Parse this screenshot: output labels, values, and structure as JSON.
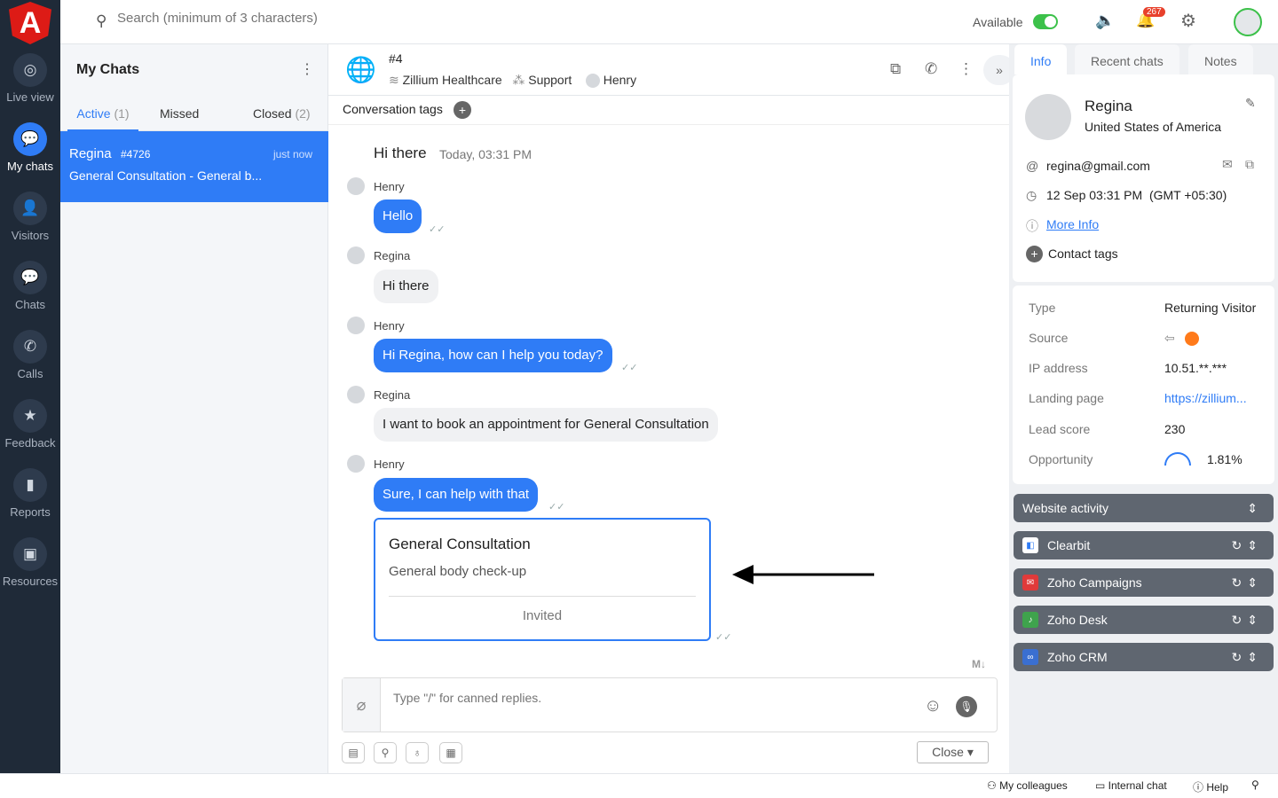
{
  "topbar": {
    "search_placeholder": "Search (minimum of 3 characters)",
    "status": "Available",
    "notifications": "267"
  },
  "sidebar": {
    "logo": "A",
    "items": [
      {
        "label": "Live view",
        "icon": "◎"
      },
      {
        "label": "My chats",
        "icon": "💬"
      },
      {
        "label": "Visitors",
        "icon": "👤"
      },
      {
        "label": "Chats",
        "icon": "💬"
      },
      {
        "label": "Calls",
        "icon": "✆"
      },
      {
        "label": "Feedback",
        "icon": "★"
      },
      {
        "label": "Reports",
        "icon": "▮"
      },
      {
        "label": "Resources",
        "icon": "▣"
      }
    ]
  },
  "list": {
    "title": "My Chats",
    "tabs": [
      {
        "label": "Active",
        "count": "(1)"
      },
      {
        "label": "Missed",
        "count": ""
      },
      {
        "label": "Closed",
        "count": "(2)"
      }
    ],
    "items": [
      {
        "name": "Regina",
        "id": "#4726",
        "time": "just now",
        "preview": "General Consultation - General b..."
      }
    ]
  },
  "chat": {
    "id": "#4",
    "company": "Zillium Healthcare",
    "department": "Support",
    "agent": "Henry",
    "tags_label": "Conversation tags",
    "header_title": "Hi there",
    "header_time": "Today, 03:31 PM",
    "messages": [
      {
        "sender": "Henry",
        "text": "Hello"
      },
      {
        "sender": "Regina",
        "text": "Hi there"
      },
      {
        "sender": "Henry",
        "text": "Hi Regina, how can I help you today?"
      },
      {
        "sender": "Regina",
        "text": "I want to book an appointment for General Consultation"
      },
      {
        "sender": "Henry",
        "text": "Sure, I can help with that"
      }
    ],
    "invite_card": {
      "title": "General Consultation",
      "subtitle": "General body check-up",
      "status": "Invited"
    },
    "markdown": "M↓",
    "input_placeholder": "Type \"/\" for canned replies.",
    "close_label": "Close"
  },
  "right": {
    "tabs": [
      "Info",
      "Recent chats",
      "Notes"
    ],
    "visitor": {
      "name": "Regina",
      "country": "United States of America",
      "email": "regina@gmail.com",
      "time": "12 Sep 03:31 PM  (GMT +05:30)",
      "more": "More Info",
      "tags": "Contact tags"
    },
    "details": [
      {
        "k": "Type",
        "v": "Returning Visitor"
      },
      {
        "k": "Source",
        "v": ""
      },
      {
        "k": "IP address",
        "v": "10.51.**.***"
      },
      {
        "k": "Landing page",
        "v": "https://zillium..."
      },
      {
        "k": "Lead score",
        "v": "230"
      },
      {
        "k": "Opportunity",
        "v": "1.81%"
      }
    ],
    "integrations": [
      "Website activity",
      "Clearbit",
      "Zoho Campaigns",
      "Zoho Desk",
      "Zoho CRM"
    ]
  },
  "bottom": {
    "items": [
      "My colleagues",
      "Internal chat",
      "Help"
    ]
  }
}
